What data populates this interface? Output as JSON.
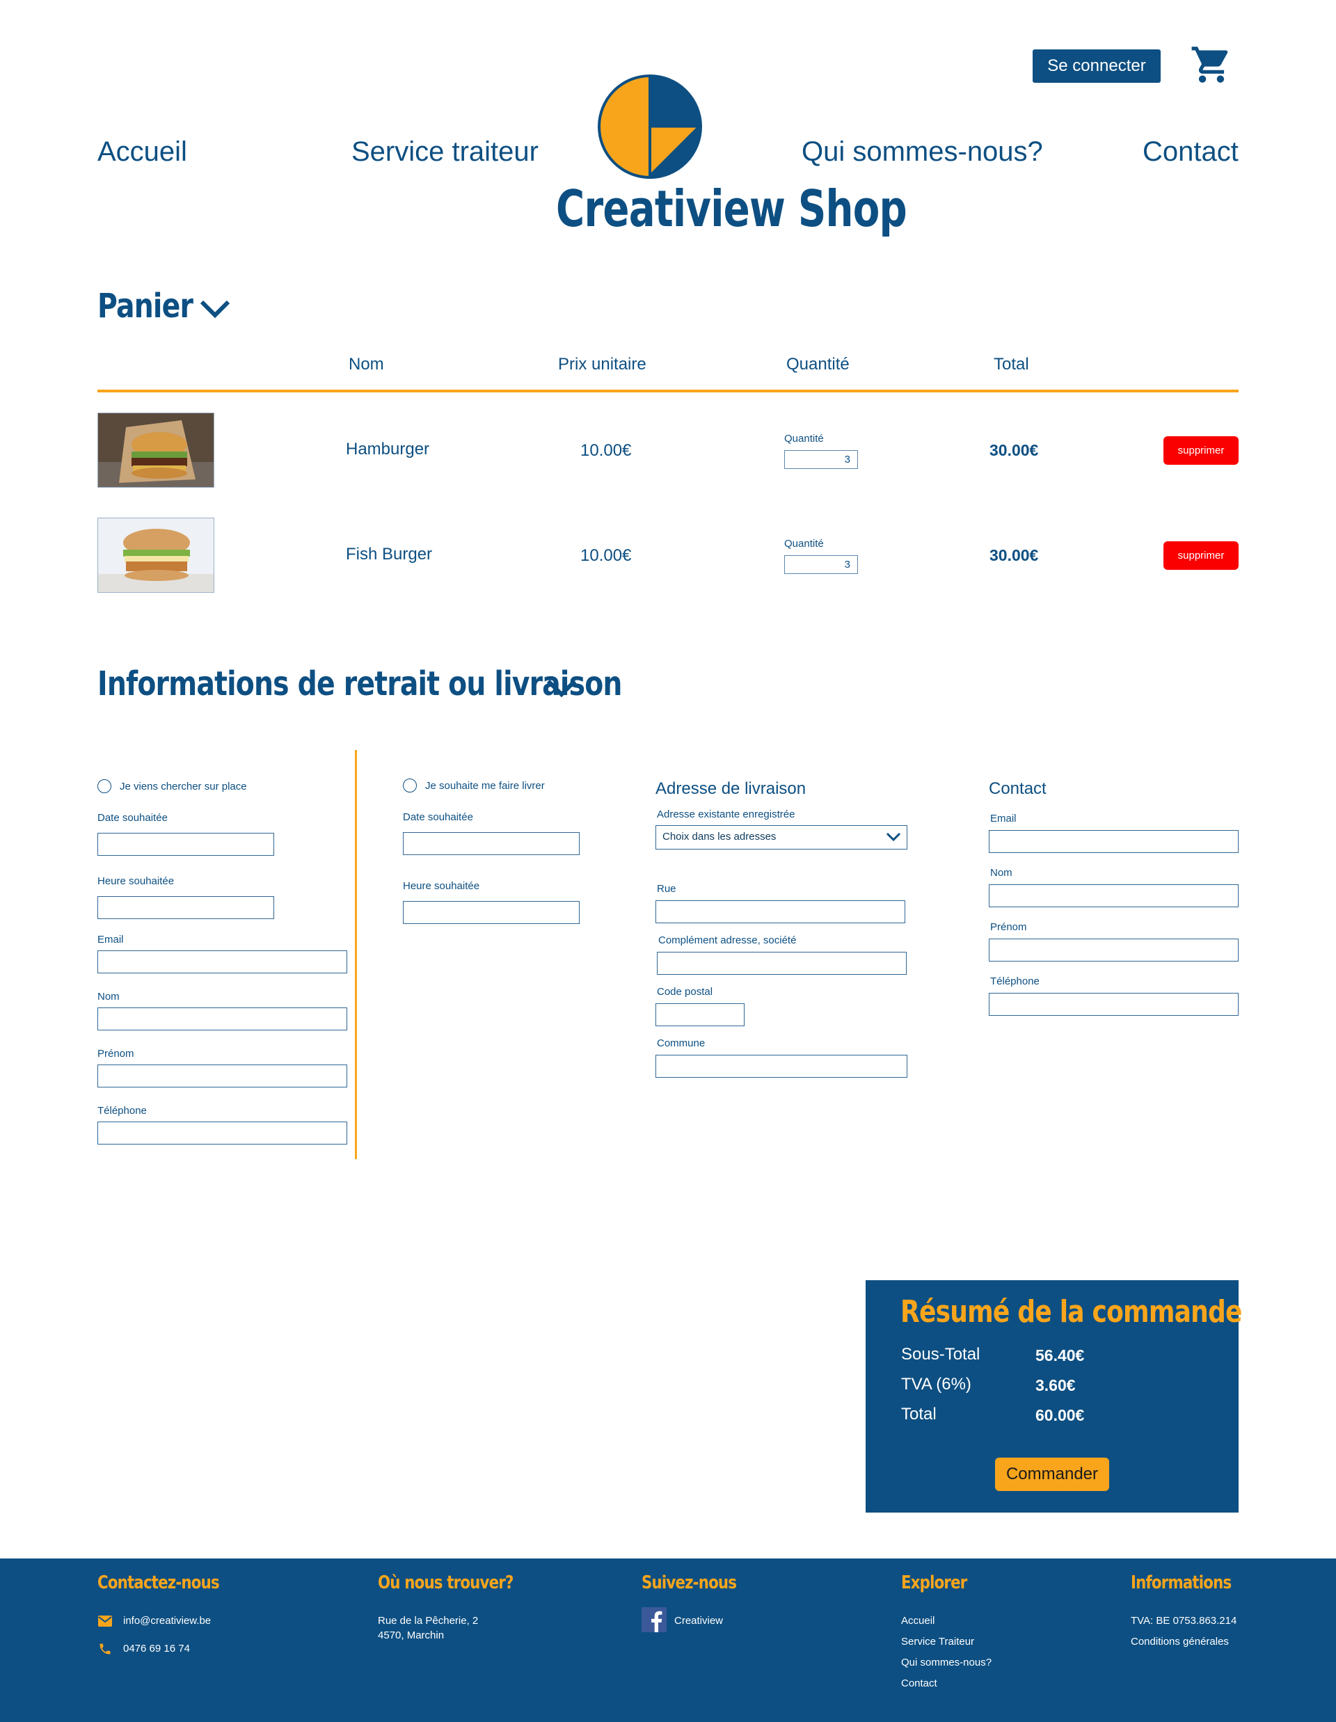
{
  "header": {
    "login_label": "Se connecter",
    "cart_icon": "cart-icon",
    "brand_name": "Creatiview Shop",
    "nav": [
      "Accueil",
      "Service traiteur",
      "Qui sommes-nous?",
      "Contact"
    ]
  },
  "cart": {
    "title": "Panier",
    "columns": [
      "Nom",
      "Prix unitaire",
      "Quantité",
      "Total"
    ],
    "items": [
      {
        "name": "Hamburger",
        "price": "10.00€",
        "qty_label": "Quantité",
        "qty": "3",
        "total": "30.00€",
        "delete_label": "supprimer"
      },
      {
        "name": "Fish Burger",
        "price": "10.00€",
        "qty_label": "Quantité",
        "qty": "3",
        "total": "30.00€",
        "delete_label": "supprimer"
      }
    ]
  },
  "delivery": {
    "title": "Informations de retrait ou livraison",
    "pickup": {
      "radio_label": "Je viens chercher sur place",
      "date_label": "Date souhaitée",
      "time_label": "Heure souhaitée",
      "email_label": "Email",
      "nom_label": "Nom",
      "prenom_label": "Prénom",
      "tel_label": "Téléphone"
    },
    "ship": {
      "radio_label": "Je souhaite me faire livrer",
      "date_label": "Date souhaitée",
      "time_label": "Heure souhaitée"
    },
    "address": {
      "title": "Adresse de livraison",
      "existing_label": "Adresse existante enregistrée",
      "select_value": "Choix dans les adresses",
      "rue_label": "Rue",
      "complement_label": "Complément adresse, société",
      "cp_label": "Code postal",
      "commune_label": "Commune"
    },
    "contact": {
      "title": "Contact",
      "email_label": "Email",
      "nom_label": "Nom",
      "prenom_label": "Prénom",
      "tel_label": "Téléphone"
    }
  },
  "summary": {
    "title": "Résumé de la commande",
    "subtotal_label": "Sous-Total",
    "subtotal": "56.40€",
    "tva_label": "TVA (6%)",
    "tva": "3.60€",
    "total_label": "Total",
    "total": "60.00€",
    "order_label": "Commander"
  },
  "footer": {
    "contact_title": "Contactez-nous",
    "email": "info@creatiview.be",
    "phone": "0476 69 16 74",
    "where_title": "Où nous trouver?",
    "address_line1": "Rue de la Pêcherie, 2",
    "address_line2": "4570, Marchin",
    "follow_title": "Suivez-nous",
    "facebook_label": "Creatiview",
    "explore_title": "Explorer",
    "explore_links": [
      "Accueil",
      "Service Traiteur",
      "Qui sommes-nous?",
      "Contact"
    ],
    "info_title": "Informations",
    "tva": "TVA: BE 0753.863.214",
    "conditions": "Conditions générales"
  },
  "colors": {
    "primary": "#0d4f82",
    "accent": "#f9a51c",
    "danger": "#fb0000"
  }
}
